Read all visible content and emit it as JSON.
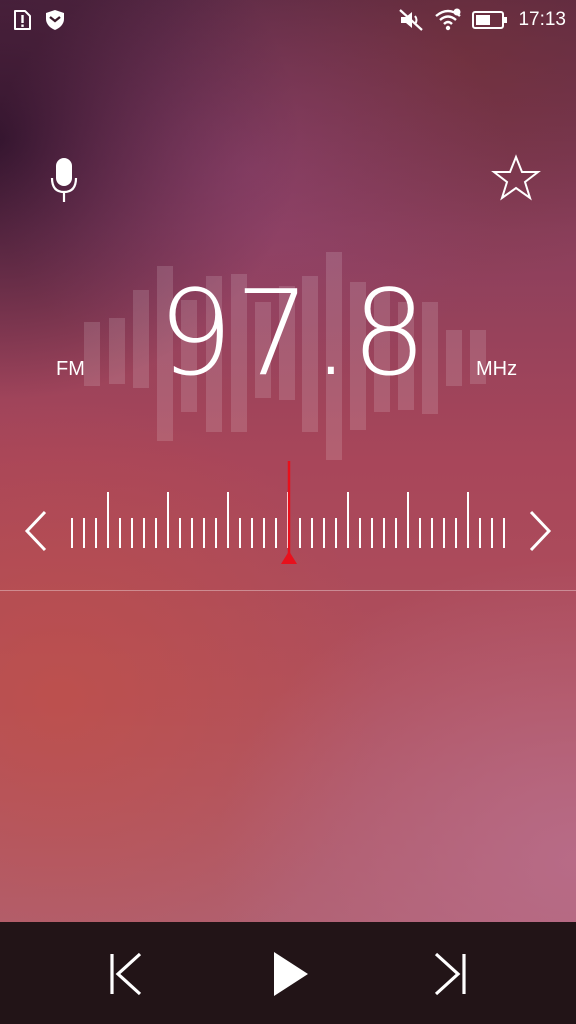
{
  "status_bar": {
    "time": "17:13",
    "icons": [
      "sim-alert-icon",
      "shield-icon",
      "mute-icon",
      "wifi-icon",
      "battery-icon"
    ]
  },
  "radio": {
    "band": "FM",
    "frequency": "97.8",
    "unit": "MHz"
  },
  "actions": {
    "left_icon": "microphone-icon",
    "right_icon": "star-icon"
  },
  "tuner": {
    "prev_icon": "chevron-left-icon",
    "next_icon": "chevron-right-icon",
    "pointer_color": "#e8101c"
  },
  "controls": {
    "icons": [
      "skip-previous-icon",
      "play-icon",
      "skip-next-icon"
    ],
    "background": "#221417"
  },
  "colors": {
    "accent": "#e8101c",
    "foreground": "#ffffff"
  }
}
